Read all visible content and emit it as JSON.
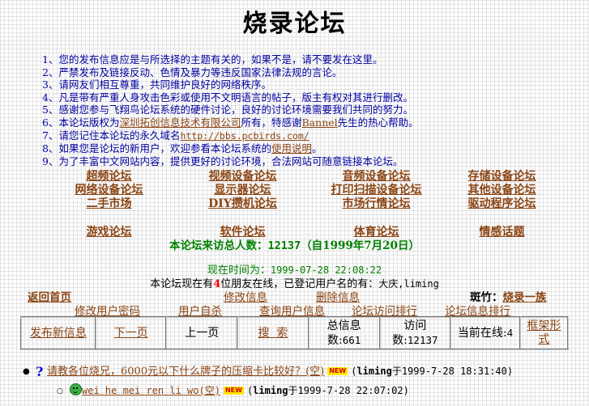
{
  "title": "烧录论坛",
  "rules": [
    {
      "n": "1、",
      "text": "您的发布信息应是与所选择的主题有关的，如果不是，请不要发在这里。"
    },
    {
      "n": "2、",
      "text": "严禁发布及链接反动、色情及暴力等违反国家法律法规的言论。"
    },
    {
      "n": "3、",
      "text": "请网友们相互尊重，共同维护良好的网络秩序。"
    },
    {
      "n": "4、",
      "text": "凡是带有严重人身攻击色彩或使用不文明语言的帖子，版主有权对其进行删改。"
    },
    {
      "n": "5、",
      "text": "感谢您参与飞翔鸟论坛系统的硬件讨论，良好的讨论环境需要我们共同的努力。"
    },
    {
      "n": "6、",
      "text_a": "本论坛版权为",
      "link_a": "深圳拓创信息技术有限公司",
      "text_b": "所有，特感谢",
      "link_b": "Bannel",
      "text_c": "先生的热心帮助。"
    },
    {
      "n": "7、",
      "text_a": "请您记住本论坛的永久域名",
      "link_a": "http://bbs.pcbirds.com/"
    },
    {
      "n": "8、",
      "text_a": "如果您是论坛的新用户，欢迎参看本论坛系统的",
      "link_a": "使用说明",
      "text_b": "。"
    },
    {
      "n": "9、",
      "text": "为了丰富中文网站内容，提供更好的讨论环境，合法网站可随意链接本论坛。"
    }
  ],
  "forums": [
    "超频论坛",
    "视频设备论坛",
    "音频设备论坛",
    "存储设备论坛",
    "网络设备论坛",
    "显示器论坛",
    "打印扫描设备论坛",
    "其他设备论坛",
    "二手市场",
    "DIY攒机论坛",
    "市场行情论坛",
    "驱动程序论坛"
  ],
  "forums_row2": [
    "游戏论坛",
    "软件论坛",
    "体育论坛",
    "情感话题"
  ],
  "visitors": {
    "label": "本论坛来访总人数：",
    "count": "12137",
    "since": "（自1999年7月20日）"
  },
  "current_time": {
    "label": "现在时间为：",
    "value": "1999-07-28 22:08:22"
  },
  "online": {
    "prefix": "本论坛现在有",
    "count": "4",
    "middle": "位朋友在线，已登记用户名的有：",
    "users": "大庆,liming"
  },
  "nav": {
    "home": "返回首页",
    "edit_info": "修改信息",
    "delete_info": "删除信息",
    "moderator_label": "斑竹：",
    "moderator": "烧录一族",
    "change_password": "修改用户密码",
    "user_intro": "用户自杀",
    "view_user": "查询用户信息",
    "visit_rank": "论坛访问排行",
    "info_rank": "论坛信息排行"
  },
  "toolbar": {
    "post_new": "发布新信息",
    "next_page": "下一页",
    "prev_page": "上一页",
    "search": "搜  索",
    "total_label": "总信息数:",
    "total": "661",
    "visits_label": "访问数:",
    "visits": "12137",
    "online_label": "当前在线:",
    "online": "4",
    "frame_view": "框架形式"
  },
  "posts": [
    {
      "title": "请教各位烧兄，6000元以下什么牌子的压缩卡比较好？(空)",
      "badge": "NEW",
      "user": "liming",
      "date_pre": "于",
      "date": "1999-7-28 18:31:40",
      "icon": "question-icon"
    },
    {
      "title": "wei he mei ren li wo(空)",
      "badge": "NEW",
      "user": "liming",
      "date_pre": "于",
      "date": "1999-7-28 22:07:02",
      "icon": "smiley-icon"
    }
  ],
  "colors": {
    "rule_text": "#0000a0",
    "link": "#8b4513",
    "green": "#008000",
    "red": "#ff0000"
  }
}
